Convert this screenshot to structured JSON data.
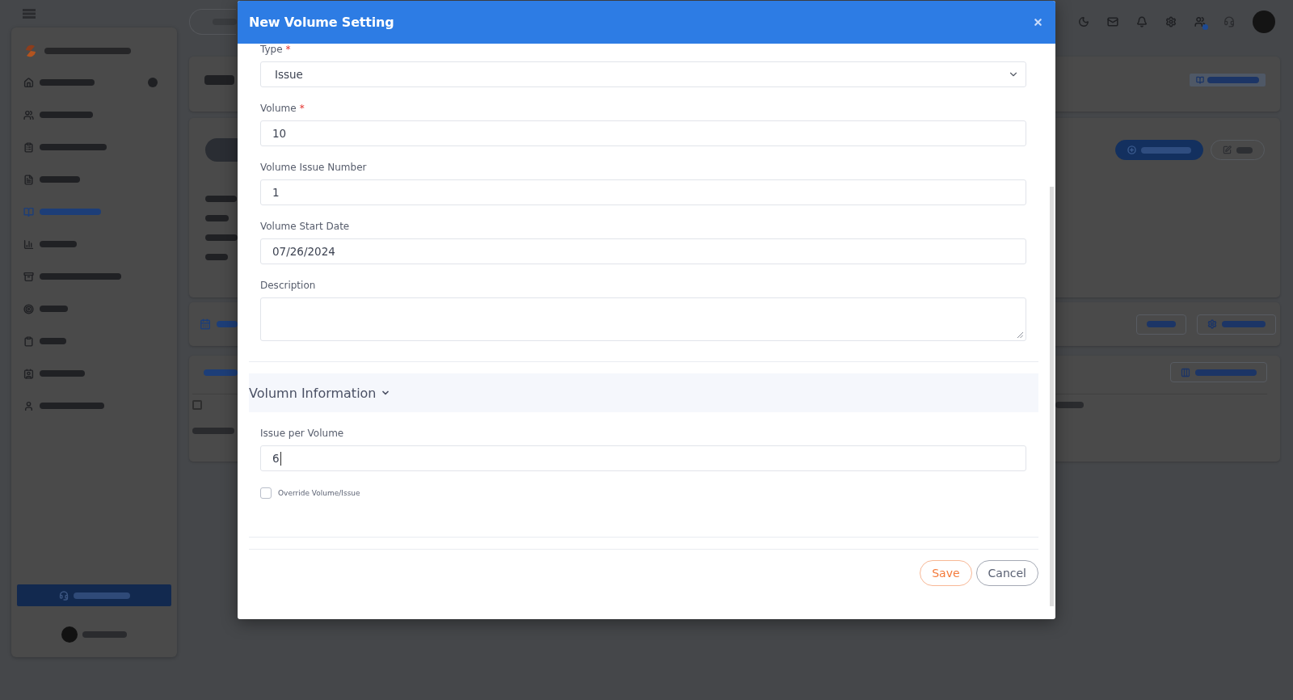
{
  "sidebar": {
    "items": [
      {
        "selected": false
      },
      {
        "selected": false
      },
      {
        "selected": false
      },
      {
        "selected": false
      },
      {
        "selected": true
      },
      {
        "selected": false
      },
      {
        "selected": false
      },
      {
        "selected": false
      },
      {
        "selected": false
      },
      {
        "selected": false
      },
      {
        "selected": false
      }
    ]
  },
  "page": {
    "tabs": [
      {
        "selected": true
      }
    ],
    "table": {
      "select_all": {
        "checked": false
      }
    }
  },
  "modal": {
    "title": "New Volume Setting",
    "fields": [
      {
        "kind": "select",
        "label": "Type",
        "required_mark": "*",
        "value": "Issue",
        "focused": false
      },
      {
        "kind": "input",
        "label": "Volume",
        "required_mark": "*",
        "value": "10",
        "focused": false
      },
      {
        "kind": "input",
        "label": "Volume Issue Number",
        "value": "1",
        "focused": false
      },
      {
        "kind": "input",
        "label": "Volume Start Date",
        "value": "07/26/2024",
        "focused": false
      },
      {
        "kind": "textarea",
        "label": "Description",
        "focused": false
      }
    ],
    "section": {
      "title": "Volumn Information",
      "expanded": true,
      "fields": [
        {
          "kind": "input",
          "label": "Issue per Volume",
          "value": "6",
          "focused": true
        }
      ],
      "checkbox": {
        "label": "Override Volume/Issue",
        "checked": false
      }
    },
    "buttons": [
      {
        "label": "Save",
        "kind": "primary"
      },
      {
        "label": "Cancel",
        "kind": "secondary"
      }
    ]
  }
}
